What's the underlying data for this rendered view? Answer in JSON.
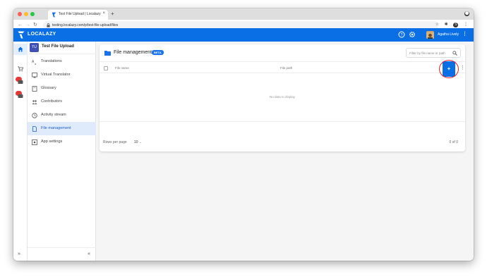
{
  "browser": {
    "tab_title": "Test File Upload | Localazy",
    "tab_close": "×",
    "new_tab": "+",
    "url": "testing.localazy.com/p/test-file-upload/files",
    "profile_initial": "S"
  },
  "header": {
    "brand": "LOCALAZY",
    "user_name": "Agatha Lively",
    "more": "⋮"
  },
  "project": {
    "initials": "TU",
    "name": "Test File Upload"
  },
  "sidebar": {
    "items": [
      {
        "label": "Translations",
        "icon": "translate-icon"
      },
      {
        "label": "Virtual Translator",
        "icon": "virtual-translator-icon"
      },
      {
        "label": "Glossary",
        "icon": "book-icon"
      },
      {
        "label": "Contributors",
        "icon": "people-icon"
      },
      {
        "label": "Activity stream",
        "icon": "history-icon"
      },
      {
        "label": "File management",
        "icon": "file-icon",
        "active": true
      },
      {
        "label": "App settings",
        "icon": "settings-icon"
      }
    ],
    "collapse": "«",
    "expand": "»"
  },
  "main": {
    "title": "File management",
    "badge": "BETA",
    "filter_placeholder": "Filter by file name or path",
    "columns": [
      "File name",
      "File path"
    ],
    "add_button": "+",
    "empty_text": "No data to display",
    "rows_per_page_label": "Rows per page",
    "rows_per_page_value": "10",
    "range_text": "0 of 0"
  },
  "colors": {
    "brand_blue": "#0a6fe4",
    "highlight_ring": "#e01f26",
    "badge_red": "#e53935"
  }
}
